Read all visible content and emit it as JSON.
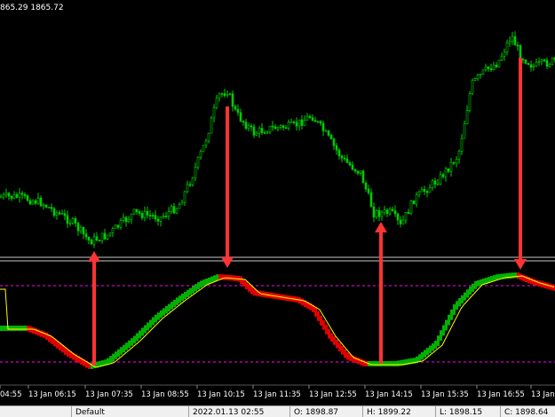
{
  "chart": {
    "header_text": "865.29 1865.72",
    "time_labels": [
      "04:55",
      "13 Jan 06:15",
      "13 Jan 07:35",
      "13 Jan 08:55",
      "13 Jan 10:15",
      "13 Jan 11:35",
      "13 Jan 12:55",
      "13 Jan 14:15",
      "13 Jan 15:35",
      "13 Jan 16:55",
      "13 Jan"
    ]
  },
  "statusbar": {
    "profile": "Default",
    "datetime": "2022.01.13 02:55",
    "open": "O: 1898.87",
    "high": "H: 1899.22",
    "low": "L: 1898.15",
    "close": "C: 1898.64"
  },
  "colors": {
    "background": "#000000",
    "bull_candle": "#00cc00",
    "osc_green": "#00b000",
    "osc_red": "#e00000",
    "signal": "#ffff00",
    "levels": "#ff00ff",
    "arrows": "#ff3333"
  },
  "icons": [
    "arrow-up-icon",
    "arrow-down-icon"
  ]
}
